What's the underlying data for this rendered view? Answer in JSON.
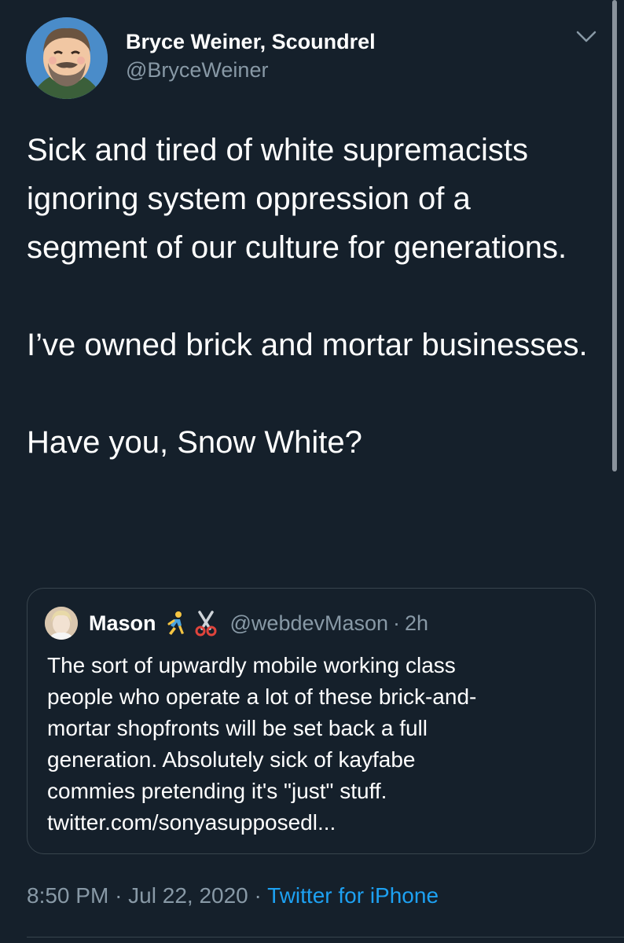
{
  "tweet": {
    "author": {
      "display_name": "Bryce Weiner, Scoundrel",
      "handle": "@BryceWeiner",
      "avatar_icon": "cartoon-avatar"
    },
    "menu_icon": "chevron-down-icon",
    "paragraphs": [
      "Sick and tired of white supremacists ignoring system oppression of a segment of our culture for generations.",
      "I’ve owned brick and mortar businesses.",
      "Have you, Snow White?"
    ],
    "quoted": {
      "author": {
        "display_name": "Mason",
        "emojis": [
          "person-running-emoji",
          "scissors-emoji"
        ],
        "handle": "@webdevMason",
        "separator": "·",
        "time": "2h"
      },
      "lines": [
        "The sort of upwardly mobile working class",
        "people who operate a lot of these brick-and-",
        "mortar shopfronts will be set back a full",
        "generation. Absolutely sick of kayfabe",
        "commies pretending it's \"just\" stuff.",
        "twitter.com/sonyasupposedl..."
      ]
    },
    "meta": {
      "time": "8:50 PM",
      "sep1": "·",
      "date": "Jul 22, 2020",
      "sep2": "·",
      "source": "Twitter for iPhone"
    }
  },
  "colors": {
    "background": "#15202b",
    "text": "#ffffff",
    "secondary": "#8899a6",
    "link": "#1da1f2",
    "border": "#38444d"
  }
}
